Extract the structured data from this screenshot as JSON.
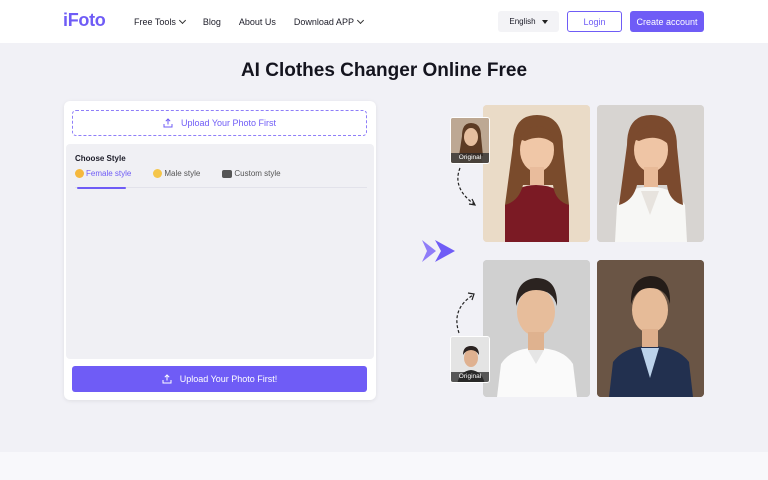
{
  "header": {
    "logo": "iFoto",
    "nav": [
      {
        "label": "Free Tools",
        "dropdown": true
      },
      {
        "label": "Blog",
        "dropdown": false
      },
      {
        "label": "About Us",
        "dropdown": false
      },
      {
        "label": "Download APP",
        "dropdown": true
      }
    ],
    "language": "English",
    "login_label": "Login",
    "create_label": "Create account"
  },
  "page": {
    "title": "AI Clothes Changer Online Free"
  },
  "tool": {
    "upload_top_label": "Upload Your Photo First",
    "choose_style_label": "Choose Style",
    "tabs": [
      {
        "label": "Female style",
        "icon": "female-emoji-icon",
        "active": true
      },
      {
        "label": "Male style",
        "icon": "male-emoji-icon",
        "active": false
      },
      {
        "label": "Custom style",
        "icon": "camera-emoji-icon",
        "active": false
      }
    ],
    "upload_bottom_label": "Upload Your Photo First!"
  },
  "showcase": {
    "original_label_1": "Original",
    "original_label_2": "Original"
  },
  "colors": {
    "accent": "#6f5cf6",
    "background": "#f1f1f6"
  }
}
